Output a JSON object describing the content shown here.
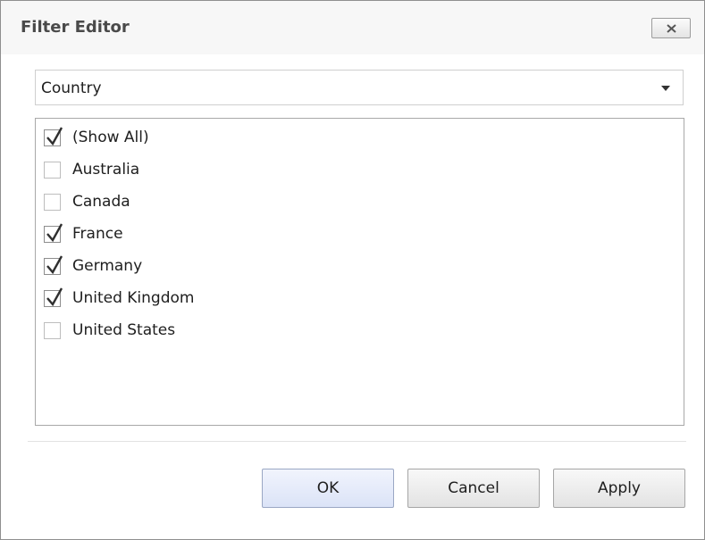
{
  "dialog": {
    "title": "Filter Editor",
    "close_icon": "close-icon"
  },
  "combo": {
    "value": "Country",
    "arrow_icon": "chevron-down-icon"
  },
  "list": {
    "items": [
      {
        "label": "(Show All)",
        "checked": true
      },
      {
        "label": "Australia",
        "checked": false
      },
      {
        "label": "Canada",
        "checked": false
      },
      {
        "label": "France",
        "checked": true
      },
      {
        "label": "Germany",
        "checked": true
      },
      {
        "label": "United Kingdom",
        "checked": true
      },
      {
        "label": "United States",
        "checked": false
      }
    ]
  },
  "buttons": {
    "ok": "OK",
    "cancel": "Cancel",
    "apply": "Apply"
  },
  "colors": {
    "default_button": "#dbe3f7",
    "title_text": "#4a4a4a"
  }
}
